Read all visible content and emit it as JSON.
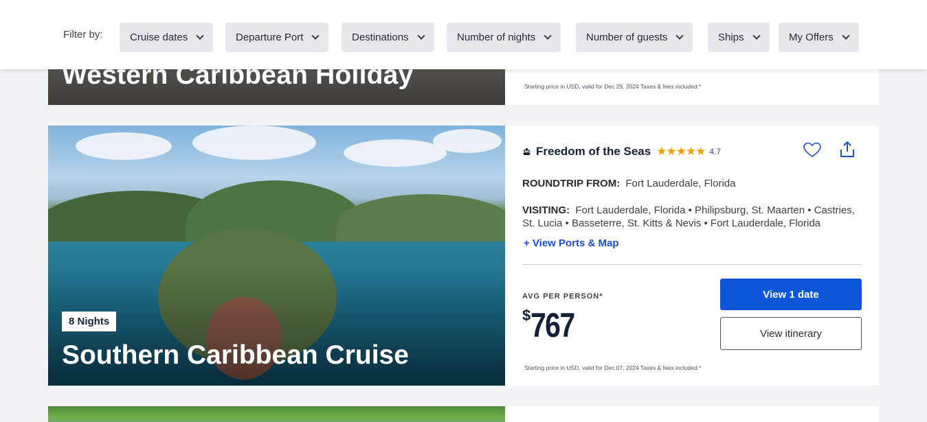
{
  "filter_bar": {
    "label": "Filter by:",
    "filters": [
      {
        "label": "Cruise dates"
      },
      {
        "label": "Departure Port"
      },
      {
        "label": "Destinations"
      },
      {
        "label": "Number of nights"
      },
      {
        "label": "Number of guests"
      },
      {
        "label": "Ships"
      },
      {
        "label": "My Offers"
      }
    ]
  },
  "cards": [
    {
      "title": "Western Caribbean Holiday",
      "fine_print": "Starting price in USD, valid for Dec 29, 2024 Taxes & fees included.*"
    },
    {
      "title": "Southern Caribbean Cruise",
      "nights": "8 Nights",
      "ship": "Freedom of the Seas",
      "stars": "★★★★★",
      "rating": "4.7",
      "roundtrip_label": "ROUNDTRIP FROM:",
      "roundtrip_value": "Fort Lauderdale, Florida",
      "visiting_label": "VISITING:",
      "visiting_value": "Fort Lauderdale, Florida • Philipsburg, St. Maarten • Castries, St. Lucia • Basseterre, St. Kitts & Nevis • Fort Lauderdale, Florida",
      "ports_link": "+ View Ports & Map",
      "avg_label": "AVG PER PERSON*",
      "currency": "$",
      "price": "767",
      "primary_button": "View 1 date",
      "secondary_button": "View itinerary",
      "fine_print": "Starting price in USD, valid for Dec 07, 2024 Taxes & fees included.*"
    }
  ],
  "icons": {
    "chevron": "chevron-down-icon",
    "ship": "ship-icon",
    "heart": "heart-icon",
    "share": "share-icon"
  },
  "colors": {
    "brand_blue": "#0d56d8",
    "navy": "#15203a",
    "star": "#f1a000",
    "link": "#1a4fd1"
  }
}
